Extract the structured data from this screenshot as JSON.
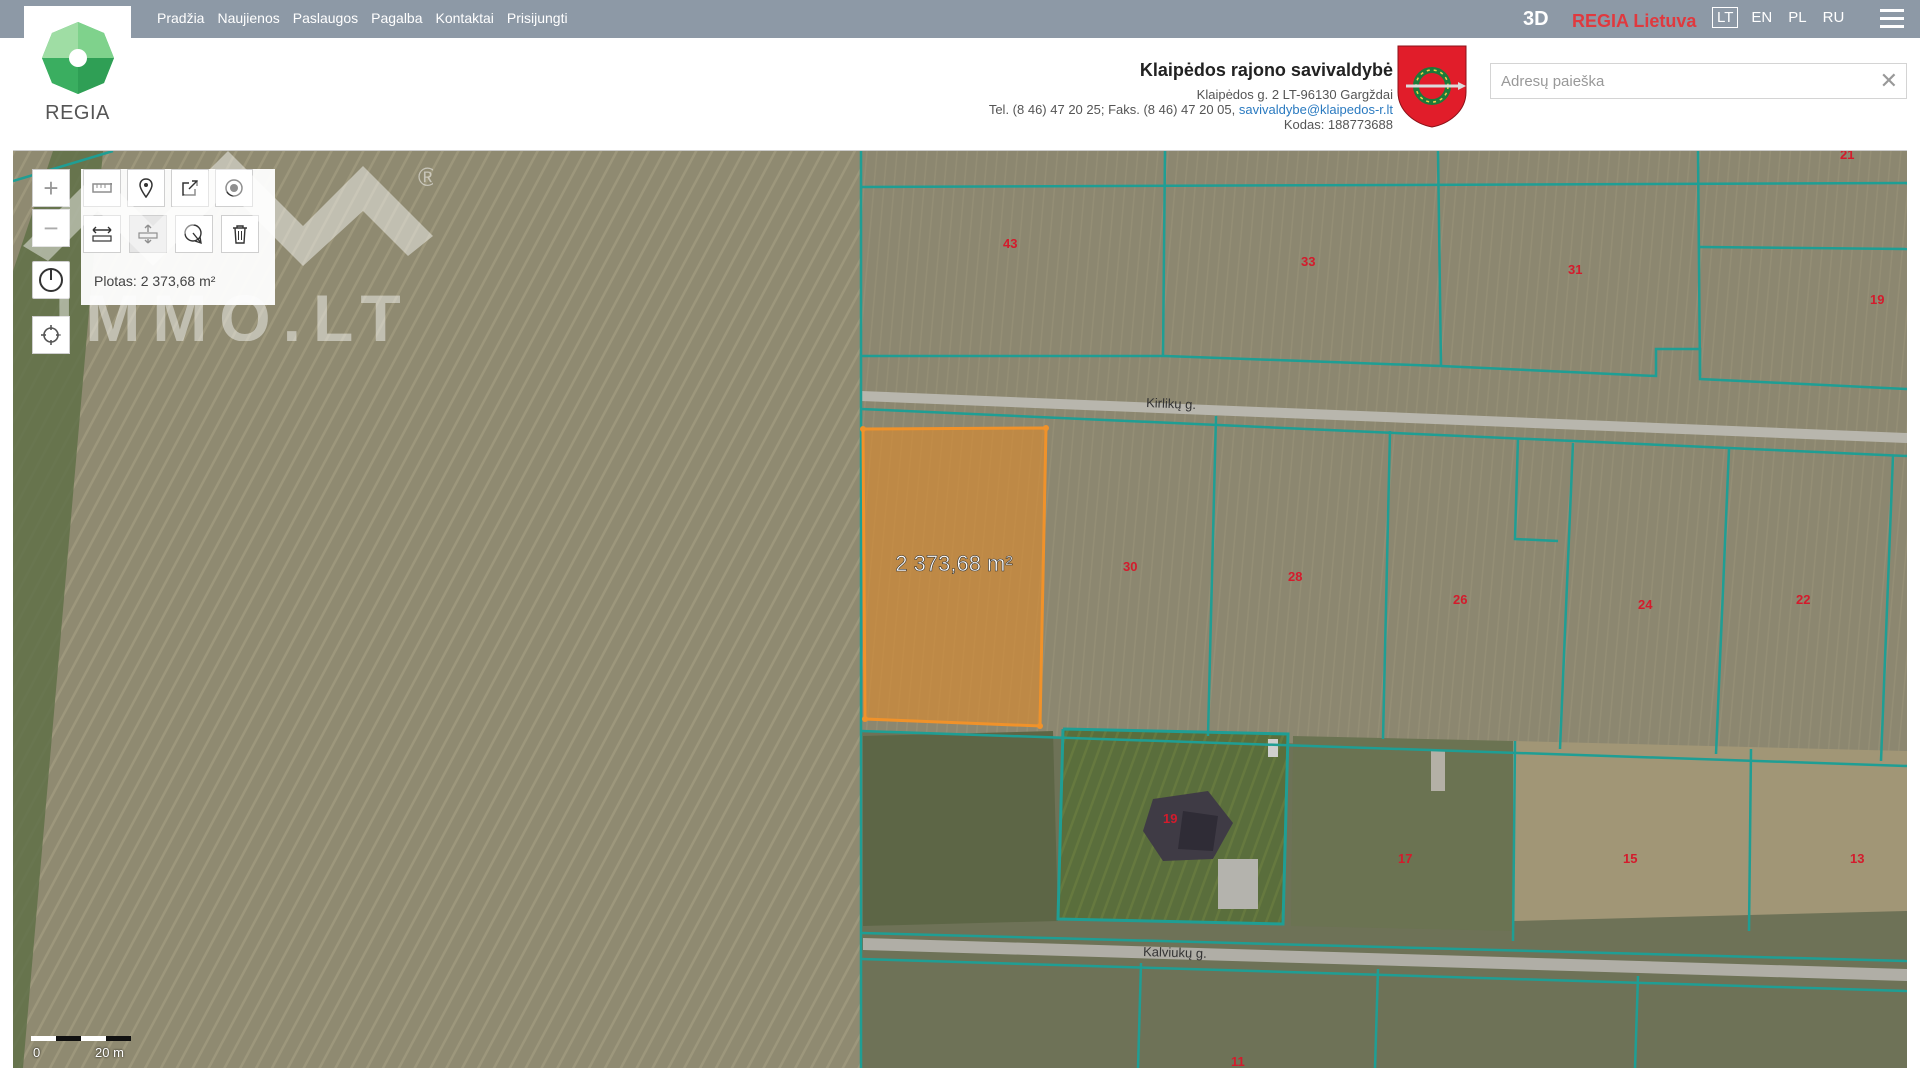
{
  "nav": {
    "items": [
      "Pradžia",
      "Naujienos",
      "Paslaugos",
      "Pagalba",
      "Kontaktai",
      "Prisijungti"
    ],
    "btn_3d": "3D",
    "regia_lt": "REGIA Lietuva",
    "languages": [
      "LT",
      "EN",
      "PL",
      "RU"
    ],
    "active_language": "LT"
  },
  "logo": {
    "text": "REGIA"
  },
  "header": {
    "municipality": "Klaipėdos rajono savivaldybė",
    "address": "Klaipėdos g. 2 LT-96130 Gargždai",
    "phone_fax": "Tel. (8 46) 47 20 25; Faks. (8 46) 47 20 05,",
    "email": "savivaldybe@klaipedos-r.lt",
    "code": "Kodas: 188773688"
  },
  "search": {
    "placeholder": "Adresų paieška",
    "value": ""
  },
  "map": {
    "measure_area_text": "Plotas: 2 373,68 m²",
    "selected_parcel_label": "2 373,68 m²",
    "selected_parcel_area_m2": 2373.68,
    "streets": [
      "Kirlikų g.",
      "Kalviukų g."
    ],
    "parcel_numbers": [
      "43",
      "33",
      "31",
      "21",
      "19",
      "30",
      "28",
      "26",
      "24",
      "22",
      "19",
      "17",
      "15",
      "13",
      "11"
    ],
    "scale": {
      "start": "0",
      "end": "20 m"
    },
    "highlight_color": "#f0922a",
    "boundary_color": "#1f9e94"
  },
  "watermark": {
    "text": "IMMO.LT",
    "mark": "®"
  }
}
